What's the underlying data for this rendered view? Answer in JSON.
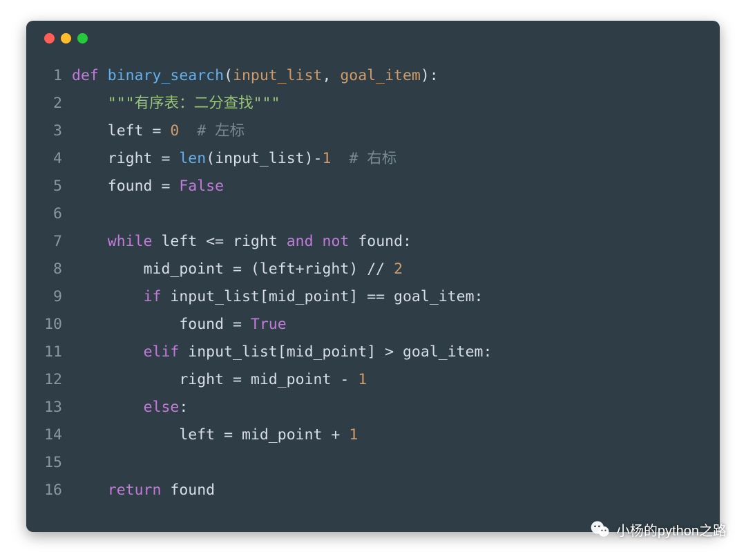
{
  "window": {
    "traffic_lights": [
      "red",
      "yellow",
      "green"
    ]
  },
  "code": {
    "language": "python",
    "lines": [
      {
        "n": 1,
        "tokens": [
          {
            "c": "tok-kw",
            "t": "def "
          },
          {
            "c": "tok-fn",
            "t": "binary_search"
          },
          {
            "c": "tok-op",
            "t": "("
          },
          {
            "c": "tok-param",
            "t": "input_list"
          },
          {
            "c": "tok-op",
            "t": ", "
          },
          {
            "c": "tok-param",
            "t": "goal_item"
          },
          {
            "c": "tok-op",
            "t": "):"
          }
        ]
      },
      {
        "n": 2,
        "tokens": [
          {
            "c": "tok-op",
            "t": "    "
          },
          {
            "c": "tok-str",
            "t": "\"\"\"有序表：二分查找\"\"\""
          }
        ]
      },
      {
        "n": 3,
        "tokens": [
          {
            "c": "tok-op",
            "t": "    "
          },
          {
            "c": "tok-id",
            "t": "left "
          },
          {
            "c": "tok-op",
            "t": "= "
          },
          {
            "c": "tok-num",
            "t": "0"
          },
          {
            "c": "tok-op",
            "t": "  "
          },
          {
            "c": "tok-com",
            "t": "# 左标"
          }
        ]
      },
      {
        "n": 4,
        "tokens": [
          {
            "c": "tok-op",
            "t": "    "
          },
          {
            "c": "tok-id",
            "t": "right "
          },
          {
            "c": "tok-op",
            "t": "= "
          },
          {
            "c": "tok-fn",
            "t": "len"
          },
          {
            "c": "tok-op",
            "t": "("
          },
          {
            "c": "tok-id",
            "t": "input_list"
          },
          {
            "c": "tok-op",
            "t": ")-"
          },
          {
            "c": "tok-num",
            "t": "1"
          },
          {
            "c": "tok-op",
            "t": "  "
          },
          {
            "c": "tok-com",
            "t": "# 右标"
          }
        ]
      },
      {
        "n": 5,
        "tokens": [
          {
            "c": "tok-op",
            "t": "    "
          },
          {
            "c": "tok-id",
            "t": "found "
          },
          {
            "c": "tok-op",
            "t": "= "
          },
          {
            "c": "tok-bool",
            "t": "False"
          }
        ]
      },
      {
        "n": 6,
        "tokens": [
          {
            "c": "tok-op",
            "t": ""
          }
        ]
      },
      {
        "n": 7,
        "tokens": [
          {
            "c": "tok-op",
            "t": "    "
          },
          {
            "c": "tok-kw",
            "t": "while"
          },
          {
            "c": "tok-op",
            "t": " "
          },
          {
            "c": "tok-id",
            "t": "left "
          },
          {
            "c": "tok-op",
            "t": "<= "
          },
          {
            "c": "tok-id",
            "t": "right "
          },
          {
            "c": "tok-kw",
            "t": "and"
          },
          {
            "c": "tok-op",
            "t": " "
          },
          {
            "c": "tok-kw",
            "t": "not"
          },
          {
            "c": "tok-op",
            "t": " "
          },
          {
            "c": "tok-id",
            "t": "found"
          },
          {
            "c": "tok-op",
            "t": ":"
          }
        ]
      },
      {
        "n": 8,
        "tokens": [
          {
            "c": "tok-op",
            "t": "        "
          },
          {
            "c": "tok-id",
            "t": "mid_point "
          },
          {
            "c": "tok-op",
            "t": "= ("
          },
          {
            "c": "tok-id",
            "t": "left"
          },
          {
            "c": "tok-op",
            "t": "+"
          },
          {
            "c": "tok-id",
            "t": "right"
          },
          {
            "c": "tok-op",
            "t": ") // "
          },
          {
            "c": "tok-num",
            "t": "2"
          }
        ]
      },
      {
        "n": 9,
        "tokens": [
          {
            "c": "tok-op",
            "t": "        "
          },
          {
            "c": "tok-kw",
            "t": "if"
          },
          {
            "c": "tok-op",
            "t": " "
          },
          {
            "c": "tok-id",
            "t": "input_list"
          },
          {
            "c": "tok-op",
            "t": "["
          },
          {
            "c": "tok-id",
            "t": "mid_point"
          },
          {
            "c": "tok-op",
            "t": "] == "
          },
          {
            "c": "tok-id",
            "t": "goal_item"
          },
          {
            "c": "tok-op",
            "t": ":"
          }
        ]
      },
      {
        "n": 10,
        "tokens": [
          {
            "c": "tok-op",
            "t": "            "
          },
          {
            "c": "tok-id",
            "t": "found "
          },
          {
            "c": "tok-op",
            "t": "= "
          },
          {
            "c": "tok-bool",
            "t": "True"
          }
        ]
      },
      {
        "n": 11,
        "tokens": [
          {
            "c": "tok-op",
            "t": "        "
          },
          {
            "c": "tok-kw",
            "t": "elif"
          },
          {
            "c": "tok-op",
            "t": " "
          },
          {
            "c": "tok-id",
            "t": "input_list"
          },
          {
            "c": "tok-op",
            "t": "["
          },
          {
            "c": "tok-id",
            "t": "mid_point"
          },
          {
            "c": "tok-op",
            "t": "] > "
          },
          {
            "c": "tok-id",
            "t": "goal_item"
          },
          {
            "c": "tok-op",
            "t": ":"
          }
        ]
      },
      {
        "n": 12,
        "tokens": [
          {
            "c": "tok-op",
            "t": "            "
          },
          {
            "c": "tok-id",
            "t": "right "
          },
          {
            "c": "tok-op",
            "t": "= "
          },
          {
            "c": "tok-id",
            "t": "mid_point "
          },
          {
            "c": "tok-op",
            "t": "- "
          },
          {
            "c": "tok-num",
            "t": "1"
          }
        ]
      },
      {
        "n": 13,
        "tokens": [
          {
            "c": "tok-op",
            "t": "        "
          },
          {
            "c": "tok-kw",
            "t": "else"
          },
          {
            "c": "tok-op",
            "t": ":"
          }
        ]
      },
      {
        "n": 14,
        "tokens": [
          {
            "c": "tok-op",
            "t": "            "
          },
          {
            "c": "tok-id",
            "t": "left "
          },
          {
            "c": "tok-op",
            "t": "= "
          },
          {
            "c": "tok-id",
            "t": "mid_point "
          },
          {
            "c": "tok-op",
            "t": "+ "
          },
          {
            "c": "tok-num",
            "t": "1"
          }
        ]
      },
      {
        "n": 15,
        "tokens": [
          {
            "c": "tok-op",
            "t": ""
          }
        ]
      },
      {
        "n": 16,
        "tokens": [
          {
            "c": "tok-op",
            "t": "    "
          },
          {
            "c": "tok-kw",
            "t": "return"
          },
          {
            "c": "tok-op",
            "t": " "
          },
          {
            "c": "tok-id",
            "t": "found"
          }
        ]
      }
    ]
  },
  "watermark": {
    "icon": "wechat-icon",
    "text": "小杨的python之路"
  }
}
